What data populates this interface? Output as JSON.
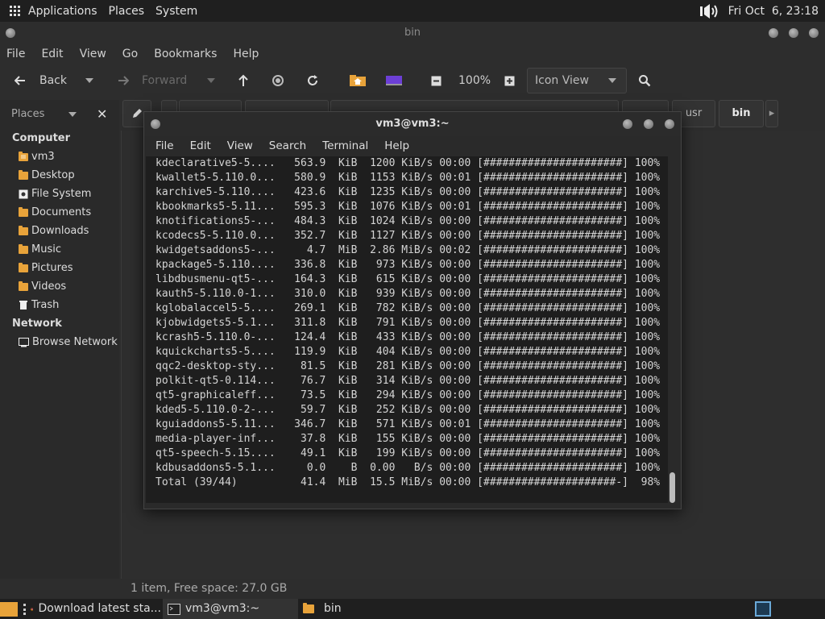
{
  "top_panel": {
    "applications": "Applications",
    "places": "Places",
    "system": "System",
    "clock": "Fri Oct  6, 23:18"
  },
  "file_manager": {
    "title": "bin",
    "menu": [
      "File",
      "Edit",
      "View",
      "Go",
      "Bookmarks",
      "Help"
    ],
    "toolbar": {
      "back": "Back",
      "forward": "Forward",
      "zoom": "100%",
      "view_mode": "Icon View"
    },
    "breadcrumbs": [
      "usr",
      "bin"
    ],
    "sidebar": {
      "header": "Places",
      "sections": [
        {
          "title": "Computer",
          "items": [
            {
              "label": "vm3",
              "icon": "home-folder-icon"
            },
            {
              "label": "Desktop",
              "icon": "folder-icon"
            },
            {
              "label": "File System",
              "icon": "drive-icon"
            },
            {
              "label": "Documents",
              "icon": "folder-icon"
            },
            {
              "label": "Downloads",
              "icon": "folder-icon"
            },
            {
              "label": "Music",
              "icon": "folder-icon"
            },
            {
              "label": "Pictures",
              "icon": "folder-icon"
            },
            {
              "label": "Videos",
              "icon": "folder-icon"
            },
            {
              "label": "Trash",
              "icon": "trash-icon"
            }
          ]
        },
        {
          "title": "Network",
          "items": [
            {
              "label": "Browse Network",
              "icon": "network-icon"
            }
          ]
        }
      ]
    },
    "status": "1 item, Free space: 27.0 GB"
  },
  "terminal": {
    "title": "vm3@vm3:~",
    "menu": [
      "File",
      "Edit",
      "View",
      "Search",
      "Terminal",
      "Help"
    ],
    "lines": [
      "kdeclarative5-5....   563.9  KiB  1200 KiB/s 00:00 [######################] 100%",
      "kwallet5-5.110.0...   580.9  KiB  1153 KiB/s 00:01 [######################] 100%",
      "karchive5-5.110....   423.6  KiB  1235 KiB/s 00:00 [######################] 100%",
      "kbookmarks5-5.11...   595.3  KiB  1076 KiB/s 00:01 [######################] 100%",
      "knotifications5-...   484.3  KiB  1024 KiB/s 00:00 [######################] 100%",
      "kcodecs5-5.110.0...   352.7  KiB  1127 KiB/s 00:00 [######################] 100%",
      "kwidgetsaddons5-...     4.7  MiB  2.86 MiB/s 00:02 [######################] 100%",
      "kpackage5-5.110....   336.8  KiB   973 KiB/s 00:00 [######################] 100%",
      "libdbusmenu-qt5-...   164.3  KiB   615 KiB/s 00:00 [######################] 100%",
      "kauth5-5.110.0-1...   310.0  KiB   939 KiB/s 00:00 [######################] 100%",
      "kglobalaccel5-5....   269.1  KiB   782 KiB/s 00:00 [######################] 100%",
      "kjobwidgets5-5.1...   311.8  KiB   791 KiB/s 00:00 [######################] 100%",
      "kcrash5-5.110.0-...   124.4  KiB   433 KiB/s 00:00 [######################] 100%",
      "kquickcharts5-5....   119.9  KiB   404 KiB/s 00:00 [######################] 100%",
      "qqc2-desktop-sty...    81.5  KiB   281 KiB/s 00:00 [######################] 100%",
      "polkit-qt5-0.114...    76.7  KiB   314 KiB/s 00:00 [######################] 100%",
      "qt5-graphicaleff...    73.5  KiB   294 KiB/s 00:00 [######################] 100%",
      "kded5-5.110.0-2-...    59.7  KiB   252 KiB/s 00:00 [######################] 100%",
      "kguiaddons5-5.11...   346.7  KiB   571 KiB/s 00:01 [######################] 100%",
      "media-player-inf...    37.8  KiB   155 KiB/s 00:00 [######################] 100%",
      "qt5-speech-5.15....    49.1  KiB   199 KiB/s 00:00 [######################] 100%",
      "kdbusaddons5-5.1...     0.0    B  0.00   B/s 00:00 [######################] 100%",
      "Total (39/44)          41.4  MiB  15.5 MiB/s 00:00 [#####################-]  98%"
    ]
  },
  "taskbar": {
    "tasks": [
      {
        "label": "Download latest sta...",
        "icon": "firefox-icon"
      },
      {
        "label": "vm3@vm3:~",
        "icon": "terminal-icon"
      },
      {
        "label": "bin",
        "icon": "folder-icon"
      }
    ]
  },
  "colors": {
    "panel_bg": "#1f1f1f",
    "window_bg": "#2d2d2d",
    "terminal_bg": "#1e1e1e",
    "folder": "#e8a33a"
  }
}
